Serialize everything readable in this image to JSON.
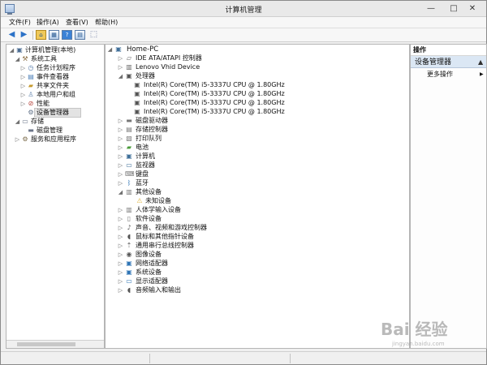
{
  "window": {
    "title": "计算机管理",
    "min": "—",
    "max": "□",
    "close": "✕"
  },
  "menu": [
    "文件(F)",
    "操作(A)",
    "查看(V)",
    "帮助(H)"
  ],
  "toolbar": {
    "icons": [
      "back-arrow-icon",
      "forward-arrow-icon",
      "up-folder-icon",
      "show-hide-tree-icon",
      "help-icon",
      "properties-icon",
      "export-icon"
    ],
    "help_label": "?"
  },
  "left_tree": [
    {
      "label": "计算机管理(本地)",
      "icon": "computer-management-icon",
      "arrow": "◢"
    },
    {
      "label": "系统工具",
      "icon": "tools-icon",
      "arrow": "◢"
    },
    {
      "label": "任务计划程序",
      "icon": "task-scheduler-icon",
      "arrow": "▷"
    },
    {
      "label": "事件查看器",
      "icon": "event-viewer-icon",
      "arrow": "▷"
    },
    {
      "label": "共享文件夹",
      "icon": "shared-folder-icon",
      "arrow": "▷"
    },
    {
      "label": "本地用户和组",
      "icon": "users-icon",
      "arrow": "▷"
    },
    {
      "label": "性能",
      "icon": "performance-icon",
      "arrow": "▷"
    },
    {
      "label": "设备管理器",
      "icon": "device-manager-icon",
      "arrow": ""
    },
    {
      "label": "存储",
      "icon": "storage-icon",
      "arrow": "◢"
    },
    {
      "label": "磁盘管理",
      "icon": "disk-management-icon",
      "arrow": ""
    },
    {
      "label": "服务和应用程序",
      "icon": "services-icon",
      "arrow": "▷"
    }
  ],
  "device_tree": {
    "root": {
      "label": "Home-PC",
      "icon": "computer-icon",
      "arrow": "◢"
    },
    "items": [
      {
        "label": "IDE ATA/ATAPI 控制器",
        "icon": "ide-controller-icon",
        "arrow": "▷"
      },
      {
        "label": "Lenovo Vhid Device",
        "icon": "hid-device-icon",
        "arrow": "▷"
      },
      {
        "label": "处理器",
        "icon": "processor-icon",
        "arrow": "◢"
      },
      {
        "label": "Intel(R) Core(TM) i5-3337U CPU @ 1.80GHz",
        "icon": "processor-icon",
        "arrow": ""
      },
      {
        "label": "Intel(R) Core(TM) i5-3337U CPU @ 1.80GHz",
        "icon": "processor-icon",
        "arrow": ""
      },
      {
        "label": "Intel(R) Core(TM) i5-3337U CPU @ 1.80GHz",
        "icon": "processor-icon",
        "arrow": ""
      },
      {
        "label": "Intel(R) Core(TM) i5-3337U CPU @ 1.80GHz",
        "icon": "processor-icon",
        "arrow": ""
      },
      {
        "label": "磁盘驱动器",
        "icon": "disk-drive-icon",
        "arrow": "▷"
      },
      {
        "label": "存储控制器",
        "icon": "storage-controller-icon",
        "arrow": "▷"
      },
      {
        "label": "打印队列",
        "icon": "printer-icon",
        "arrow": "▷"
      },
      {
        "label": "电池",
        "icon": "battery-icon",
        "arrow": "▷"
      },
      {
        "label": "计算机",
        "icon": "computer-icon",
        "arrow": "▷"
      },
      {
        "label": "监视器",
        "icon": "monitor-icon",
        "arrow": "▷"
      },
      {
        "label": "键盘",
        "icon": "keyboard-icon",
        "arrow": "▷"
      },
      {
        "label": "蓝牙",
        "icon": "bluetooth-icon",
        "arrow": "▷"
      },
      {
        "label": "其他设备",
        "icon": "other-devices-icon",
        "arrow": "◢"
      },
      {
        "label": "未知设备",
        "icon": "warning-device-icon",
        "arrow": ""
      },
      {
        "label": "人体学输入设备",
        "icon": "hid-device-icon",
        "arrow": "▷"
      },
      {
        "label": "软件设备",
        "icon": "software-device-icon",
        "arrow": "▷"
      },
      {
        "label": "声音、视频和游戏控制器",
        "icon": "sound-icon",
        "arrow": "▷"
      },
      {
        "label": "鼠标和其他指针设备",
        "icon": "mouse-icon",
        "arrow": "▷"
      },
      {
        "label": "通用串行总线控制器",
        "icon": "usb-icon",
        "arrow": "▷"
      },
      {
        "label": "图像设备",
        "icon": "camera-icon",
        "arrow": "▷"
      },
      {
        "label": "网络适配器",
        "icon": "network-adapter-icon",
        "arrow": "▷"
      },
      {
        "label": "系统设备",
        "icon": "system-device-icon",
        "arrow": "▷"
      },
      {
        "label": "显示适配器",
        "icon": "display-adapter-icon",
        "arrow": "▷"
      },
      {
        "label": "音频输入和输出",
        "icon": "audio-io-icon",
        "arrow": "▷"
      }
    ]
  },
  "actions": {
    "header": "操作",
    "section": "设备管理器",
    "more": "更多操作",
    "more_arrow": "▶"
  },
  "watermark": {
    "title": "Bai 经验",
    "url": "jingyan.baidu.com"
  },
  "colors": {
    "selected": "#dbe7f4",
    "accent": "#2f74b5",
    "warning": "#e0b43d"
  }
}
